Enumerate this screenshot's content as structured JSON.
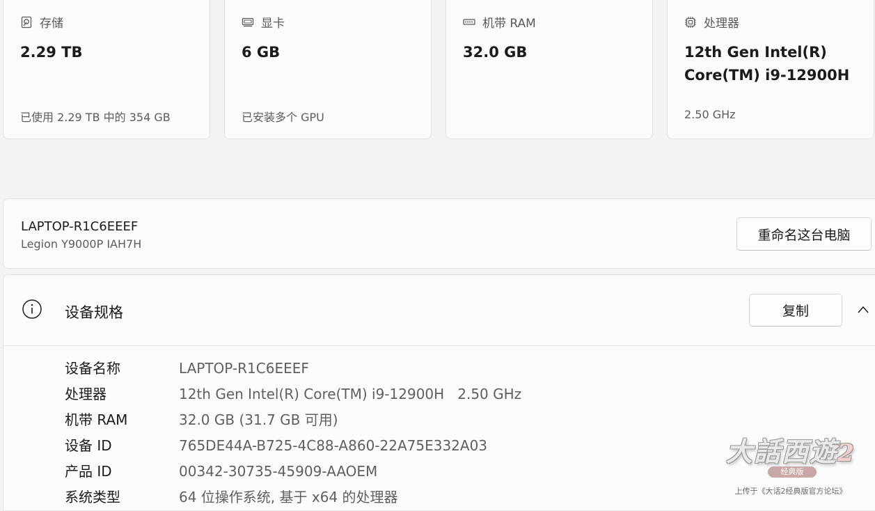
{
  "cards": [
    {
      "label": "存储",
      "icon": "storage-icon",
      "value": "2.29 TB",
      "sub": "已使用 2.29 TB 中的 354 GB"
    },
    {
      "label": "显卡",
      "icon": "gpu-icon",
      "value": "6 GB",
      "sub": "已安装多个 GPU"
    },
    {
      "label": "机带 RAM",
      "icon": "ram-icon",
      "value": "32.0 GB",
      "sub": ""
    },
    {
      "label": "处理器",
      "icon": "cpu-icon",
      "value": "12th Gen Intel(R) Core(TM) i9-12900H",
      "sub": "2.50 GHz"
    }
  ],
  "device": {
    "name": "LAPTOP-R1C6EEEF",
    "model": "Legion Y9000P IAH7H",
    "rename_label": "重命名这台电脑"
  },
  "specs": {
    "title": "设备规格",
    "copy_label": "复制",
    "rows": [
      {
        "key": "设备名称",
        "value": "LAPTOP-R1C6EEEF"
      },
      {
        "key": "处理器",
        "value": "12th Gen Intel(R) Core(TM) i9-12900H   2.50 GHz"
      },
      {
        "key": "机带 RAM",
        "value": "32.0 GB (31.7 GB 可用)"
      },
      {
        "key": "设备 ID",
        "value": "765DE44A-B725-4C88-A860-22A75E332A03"
      },
      {
        "key": "产品 ID",
        "value": "00342-30735-45909-AAOEM"
      },
      {
        "key": "系统类型",
        "value": "64 位操作系统, 基于 x64 的处理器"
      }
    ]
  },
  "watermark": {
    "logo": "大話西遊",
    "logo_num": "2",
    "badge": "经典版",
    "caption": "上传于《大话2经典版官方论坛》"
  },
  "colors": {
    "background": "#f3f3f3",
    "card": "#fbfbfb",
    "border": "#e3e3e3",
    "secondary_text": "#5c5c5c"
  }
}
